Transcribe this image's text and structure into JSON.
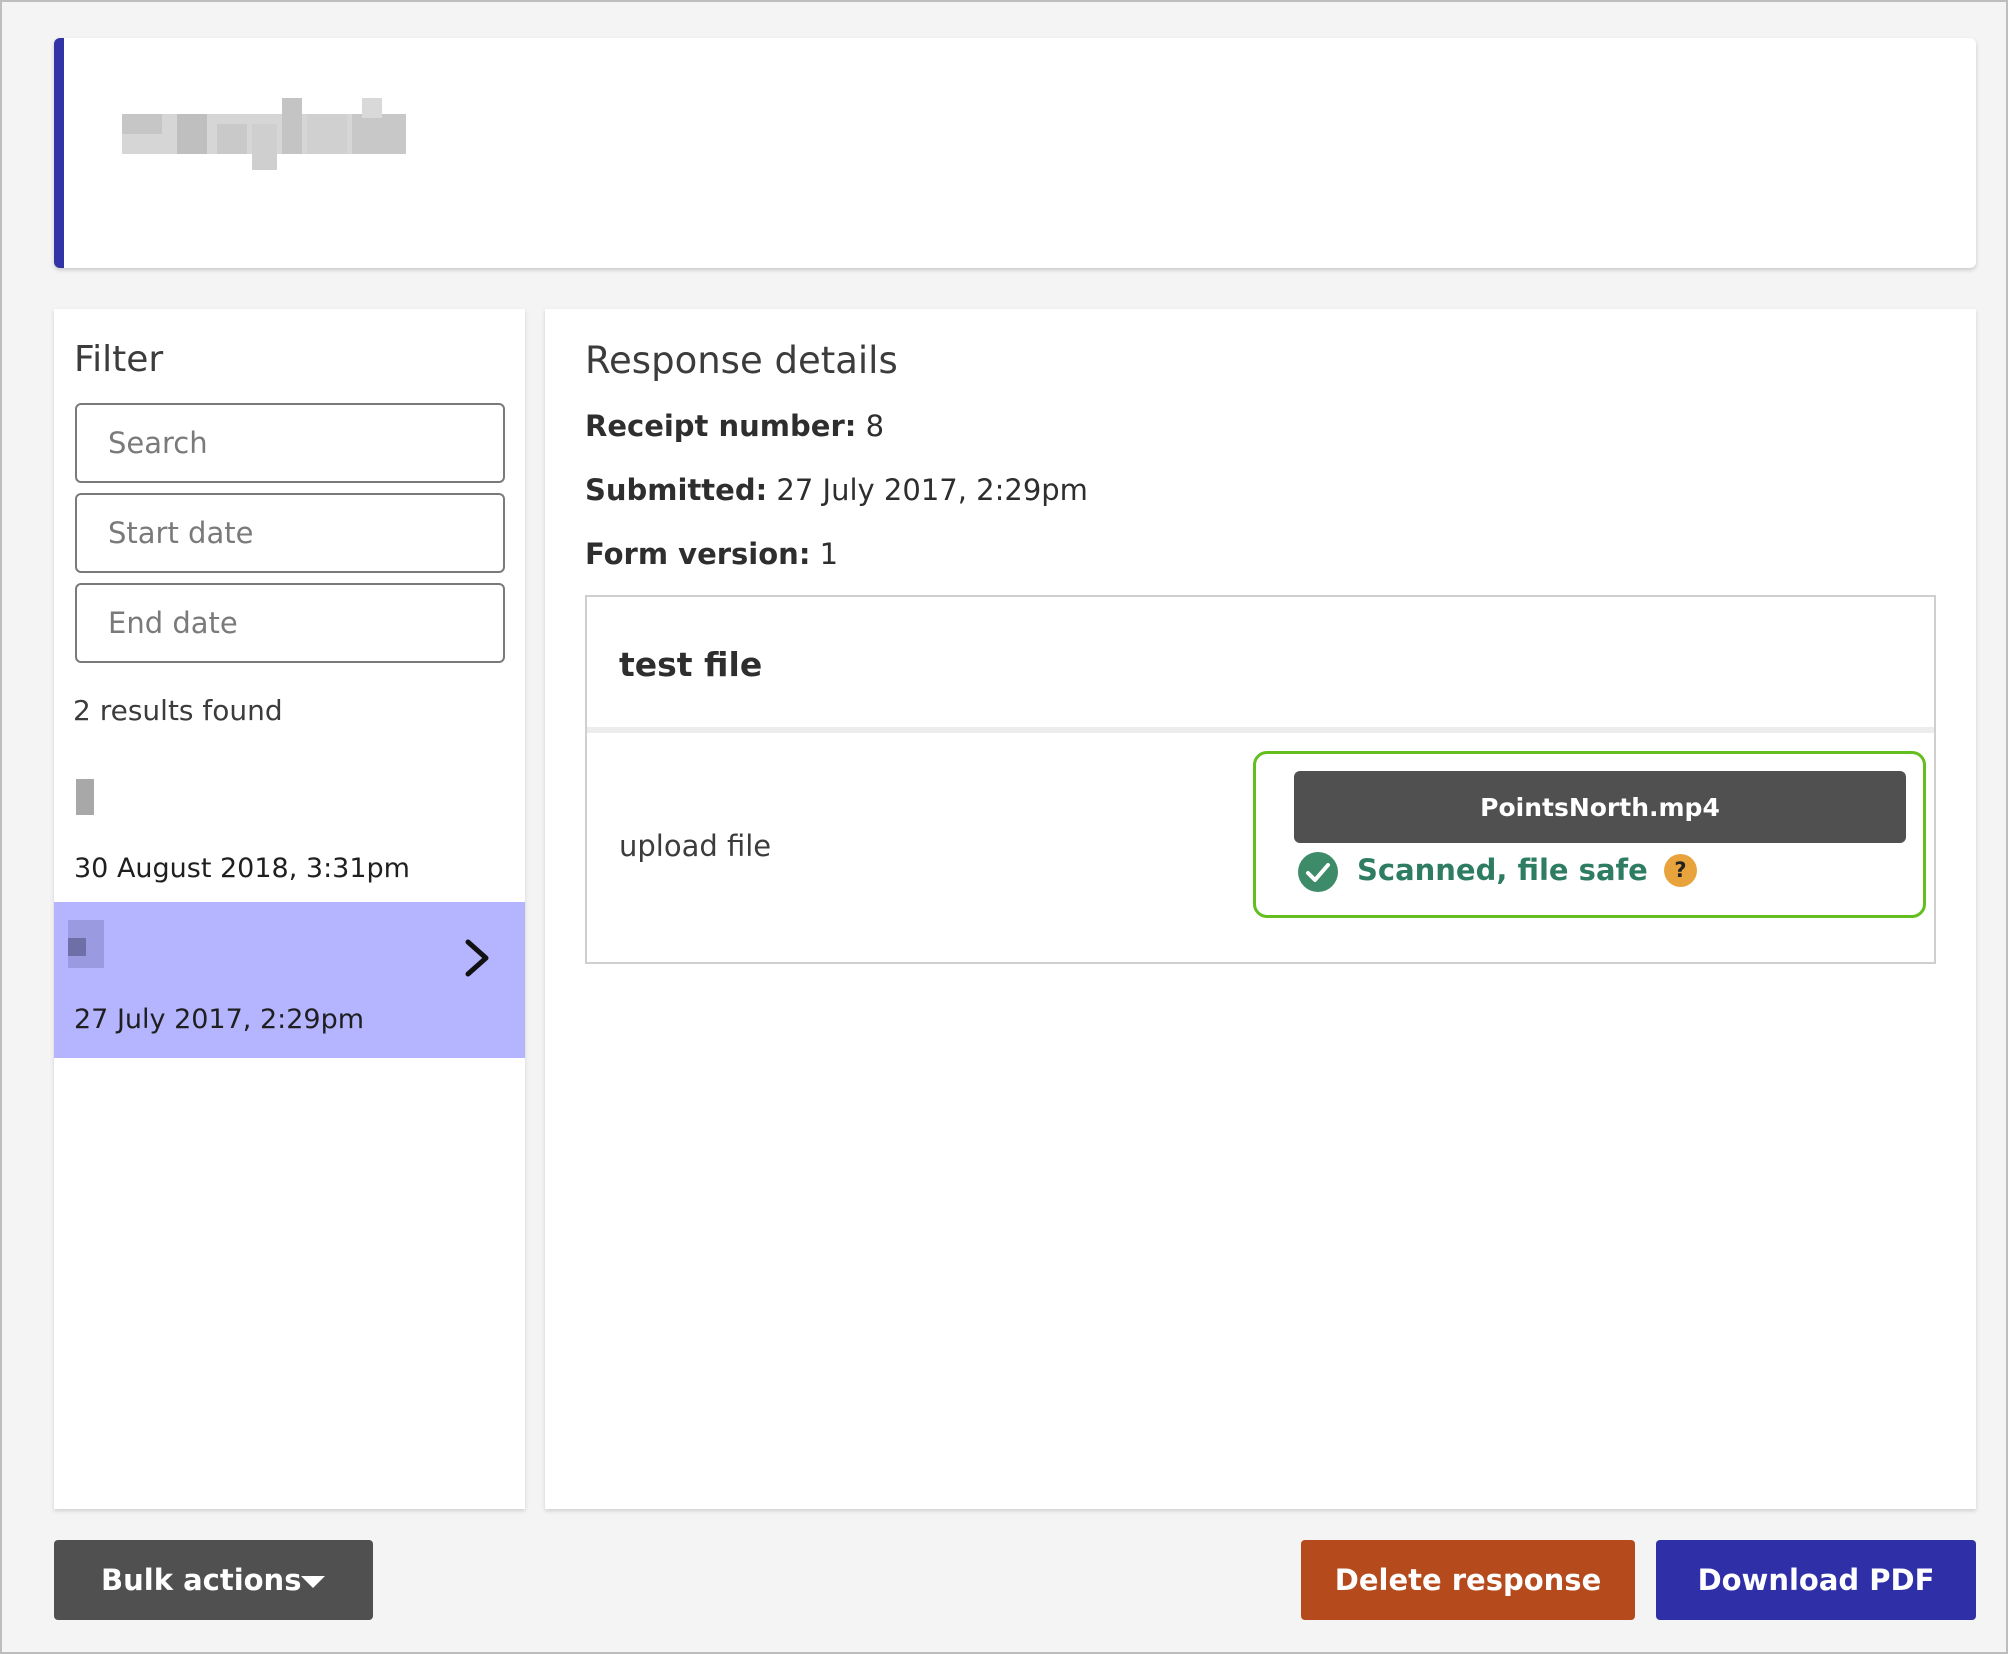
{
  "header": {
    "title_redacted": ""
  },
  "filter": {
    "title": "Filter",
    "search_placeholder": "Search",
    "start_date_placeholder": "Start date",
    "end_date_placeholder": "End date",
    "results_count": "2 results found",
    "results": [
      {
        "date": "30 August 2018, 3:31pm",
        "selected": false
      },
      {
        "date": "27 July 2017, 2:29pm",
        "selected": true
      }
    ]
  },
  "details": {
    "title": "Response details",
    "receipt_label": "Receipt number:",
    "receipt_value": "8",
    "submitted_label": "Submitted:",
    "submitted_value": "27 July 2017, 2:29pm",
    "version_label": "Form version:",
    "version_value": "1",
    "question_title": "test file",
    "field_label": "upload file",
    "file_name": "PointsNorth.mp4",
    "scan_status": "Scanned, file safe",
    "help_symbol": "?"
  },
  "actions": {
    "bulk_label": "Bulk actions",
    "delete_label": "Delete response",
    "download_label": "Download PDF"
  },
  "colors": {
    "accent": "#3333a8",
    "selected_row": "#b4b4ff",
    "safe_green": "#2e7d62",
    "file_box_border": "#63bf1f",
    "delete": "#b54a1c",
    "download": "#2f30a8",
    "dark_button": "#505050"
  }
}
